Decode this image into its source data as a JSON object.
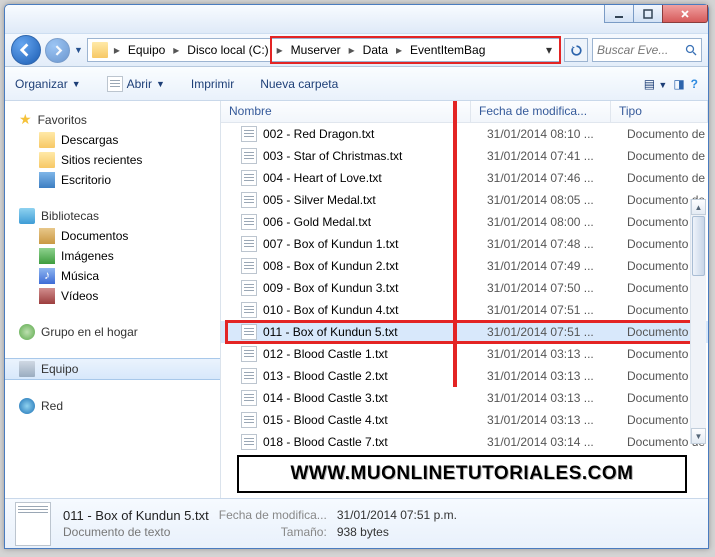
{
  "window_controls": {
    "min": "minimize",
    "max": "maximize",
    "close": "close"
  },
  "breadcrumb": {
    "items": [
      "Equipo",
      "Disco local (C:)",
      "Muserver",
      "Data",
      "EventItemBag"
    ]
  },
  "search": {
    "placeholder": "Buscar Eve..."
  },
  "toolbar": {
    "organize": "Organizar",
    "open": "Abrir",
    "print": "Imprimir",
    "newfolder": "Nueva carpeta"
  },
  "sidebar": {
    "favorites": {
      "label": "Favoritos",
      "items": [
        "Descargas",
        "Sitios recientes",
        "Escritorio"
      ]
    },
    "libraries": {
      "label": "Bibliotecas",
      "items": [
        "Documentos",
        "Imágenes",
        "Música",
        "Vídeos"
      ]
    },
    "homegroup": {
      "label": "Grupo en el hogar"
    },
    "computer": {
      "label": "Equipo"
    },
    "network": {
      "label": "Red"
    }
  },
  "columns": {
    "name": "Nombre",
    "date": "Fecha de modifica...",
    "type": "Tipo"
  },
  "files": [
    {
      "name": "002 - Red Dragon.txt",
      "date": "31/01/2014 08:10 ...",
      "type": "Documento de",
      "sel": false
    },
    {
      "name": "003 - Star of Christmas.txt",
      "date": "31/01/2014 07:41 ...",
      "type": "Documento de",
      "sel": false
    },
    {
      "name": "004 - Heart of Love.txt",
      "date": "31/01/2014 07:46 ...",
      "type": "Documento de",
      "sel": false
    },
    {
      "name": "005 - Silver Medal.txt",
      "date": "31/01/2014 08:05 ...",
      "type": "Documento de",
      "sel": false
    },
    {
      "name": "006 - Gold Medal.txt",
      "date": "31/01/2014 08:00 ...",
      "type": "Documento de",
      "sel": false
    },
    {
      "name": "007 - Box of Kundun 1.txt",
      "date": "31/01/2014 07:48 ...",
      "type": "Documento de",
      "sel": false
    },
    {
      "name": "008 - Box of Kundun 2.txt",
      "date": "31/01/2014 07:49 ...",
      "type": "Documento de",
      "sel": false
    },
    {
      "name": "009 - Box of Kundun 3.txt",
      "date": "31/01/2014 07:50 ...",
      "type": "Documento de",
      "sel": false
    },
    {
      "name": "010 - Box of Kundun 4.txt",
      "date": "31/01/2014 07:51 ...",
      "type": "Documento de",
      "sel": false
    },
    {
      "name": "011 - Box of Kundun 5.txt",
      "date": "31/01/2014 07:51 ...",
      "type": "Documento d",
      "sel": true
    },
    {
      "name": "012 - Blood Castle 1.txt",
      "date": "31/01/2014 03:13 ...",
      "type": "Documento de",
      "sel": false
    },
    {
      "name": "013 - Blood Castle 2.txt",
      "date": "31/01/2014 03:13 ...",
      "type": "Documento de",
      "sel": false
    },
    {
      "name": "014 - Blood Castle 3.txt",
      "date": "31/01/2014 03:13 ...",
      "type": "Documento de",
      "sel": false
    },
    {
      "name": "015 - Blood Castle 4.txt",
      "date": "31/01/2014 03:13 ...",
      "type": "Documento de",
      "sel": false
    },
    {
      "name": "018 - Blood Castle 7.txt",
      "date": "31/01/2014 03:14 ...",
      "type": "Documento de",
      "sel": false
    }
  ],
  "banner": "WWW.MUONLINETUTORIALES.COM",
  "details": {
    "title": "011 - Box of Kundun 5.txt",
    "subtitle": "Documento de texto",
    "date_k": "Fecha de modifica...",
    "date_v": "31/01/2014 07:51 p.m.",
    "size_k": "Tamaño:",
    "size_v": "938 bytes"
  }
}
